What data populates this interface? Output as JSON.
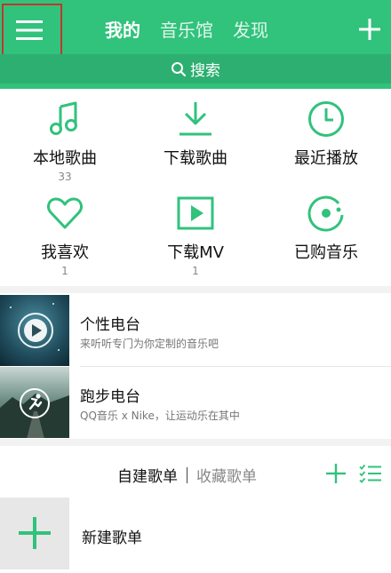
{
  "header": {
    "tabs": [
      {
        "label": "我的",
        "active": true
      },
      {
        "label": "音乐馆",
        "active": false
      },
      {
        "label": "发现",
        "active": false
      }
    ],
    "search_label": "搜索"
  },
  "grid": [
    {
      "label": "本地歌曲",
      "count": "33",
      "icon": "music-note-icon"
    },
    {
      "label": "下载歌曲",
      "count": "",
      "icon": "download-icon"
    },
    {
      "label": "最近播放",
      "count": "",
      "icon": "clock-icon"
    },
    {
      "label": "我喜欢",
      "count": "1",
      "icon": "heart-icon"
    },
    {
      "label": "下载MV",
      "count": "1",
      "icon": "video-play-icon"
    },
    {
      "label": "已购音乐",
      "count": "",
      "icon": "purchased-disc-icon"
    }
  ],
  "radios": [
    {
      "title": "个性电台",
      "subtitle": "来听听专门为你定制的音乐吧"
    },
    {
      "title": "跑步电台",
      "subtitle": "QQ音乐 x Nike，让运动乐在其中"
    }
  ],
  "playlists": {
    "tab_active": "自建歌单",
    "tab_other": "收藏歌单",
    "new_label": "新建歌单"
  },
  "colors": {
    "accent": "#31c27c",
    "accent_dark": "#2caf70",
    "highlight_border": "#c0392b"
  }
}
